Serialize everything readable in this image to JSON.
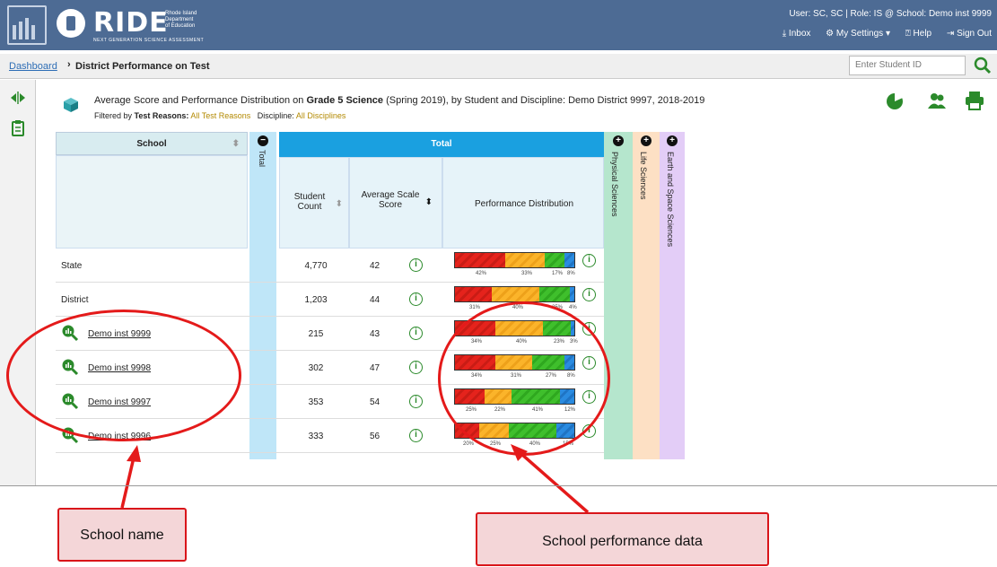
{
  "header": {
    "brand": "RIDE",
    "brand_sub": "Rhode Island Department of Education",
    "brand_tag": "NEXT GENERATION SCIENCE ASSESSMENT",
    "user_info": "User: SC, SC  |  Role: IS @ School: Demo inst 9999",
    "nav": {
      "inbox": "Inbox",
      "settings": "My Settings",
      "help": "Help",
      "signout": "Sign Out"
    }
  },
  "breadcrumb": {
    "link": "Dashboard",
    "sep": "›",
    "current": "District Performance on Test"
  },
  "search": {
    "placeholder": "Enter Student ID"
  },
  "report": {
    "title_prefix": "Average Score and Performance Distribution on ",
    "title_bold": "Grade 5 Science",
    "title_suffix": " (Spring 2019), by Student and Discipline: Demo District 9997, 2018-2019",
    "filter_prefix": "Filtered by ",
    "filter_label1": "Test Reasons:",
    "filter_value1": "All Test Reasons",
    "filter_label2": "Discipline:",
    "filter_value2": "All Disciplines"
  },
  "table": {
    "school_header": "School",
    "total_collapse_label": "Total",
    "total_header": "Total",
    "student_count_header": "Student Count",
    "avg_score_header": "Average Scale Score",
    "perf_dist_header": "Performance Distribution",
    "side_columns": [
      {
        "label": "Physical Sciences",
        "color": "#b5e6cd"
      },
      {
        "label": "Life Sciences",
        "color": "#fde0c4"
      },
      {
        "label": "Earth and Space Sciences",
        "color": "#e3cdf7"
      }
    ],
    "rows": [
      {
        "name": "State",
        "link": false,
        "count": "4,770",
        "score": "42",
        "dist": [
          42,
          33,
          17,
          8
        ],
        "labels": [
          "42%",
          "33%",
          "17%",
          "8%"
        ]
      },
      {
        "name": "District",
        "link": false,
        "count": "1,203",
        "score": "44",
        "dist": [
          31,
          40,
          25,
          4
        ],
        "labels": [
          "31%",
          "40%",
          "25%",
          "4%"
        ]
      },
      {
        "name": "Demo inst 9999",
        "link": true,
        "count": "215",
        "score": "43",
        "dist": [
          34,
          40,
          23,
          3
        ],
        "labels": [
          "34%",
          "40%",
          "23%",
          "3%"
        ]
      },
      {
        "name": "Demo inst 9998",
        "link": true,
        "count": "302",
        "score": "47",
        "dist": [
          34,
          31,
          27,
          8
        ],
        "labels": [
          "34%",
          "31%",
          "27%",
          "8%"
        ]
      },
      {
        "name": "Demo inst 9997",
        "link": true,
        "count": "353",
        "score": "54",
        "dist": [
          25,
          22,
          41,
          12
        ],
        "labels": [
          "25%",
          "22%",
          "41%",
          "12%"
        ]
      },
      {
        "name": "Demo inst 9996",
        "link": true,
        "count": "333",
        "score": "56",
        "dist": [
          20,
          25,
          40,
          15
        ],
        "labels": [
          "20%",
          "25%",
          "40%",
          "15%"
        ]
      }
    ]
  },
  "annotations": {
    "school_name": "School name",
    "school_perf": "School performance data"
  },
  "colors": {
    "header_bg": "#4d6b94",
    "total_header": "#1aa0e0",
    "annotation_red": "#e41a1a"
  }
}
